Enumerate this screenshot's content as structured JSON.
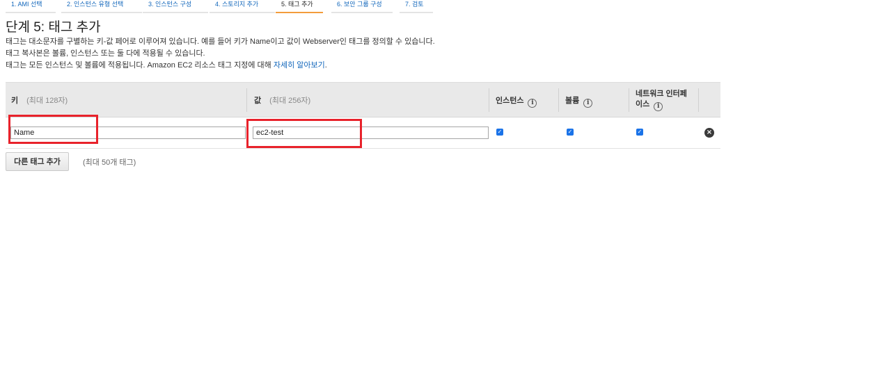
{
  "wizard": {
    "steps": [
      {
        "label": "1. AMI 선택"
      },
      {
        "label": "2. 인스턴스 유형 선택"
      },
      {
        "label": "3. 인스턴스 구성"
      },
      {
        "label": "4. 스토리지 추가"
      },
      {
        "label": "5. 태그 추가",
        "active": true
      },
      {
        "label": "6. 보안 그룹 구성"
      },
      {
        "label": "7. 검토"
      }
    ]
  },
  "page": {
    "title": "단계 5: 태그 추가",
    "desc_line1": "태그는 대소문자를 구별하는 키-값 페어로 이루어져 있습니다. 예를 들어 키가 Name이고 값이 Webserver인 태그를 정의할 수 있습니다.",
    "desc_line2": "태그 복사본은 볼륨, 인스턴스 또는 둘 다에 적용될 수 있습니다.",
    "desc_line3": "태그는 모든 인스턴스 및 볼륨에 적용됩니다. Amazon EC2 리소스 태그 지정에 대해 ",
    "learn_more_link": "자세히 알아보기",
    "desc_line3_end": "."
  },
  "table": {
    "headers": {
      "key": "키",
      "key_hint": "(최대 128자)",
      "value": "값",
      "value_hint": "(최대 256자)",
      "instances": "인스턴스",
      "volumes": "볼륨",
      "network_interfaces_line1": "네트워크 인터페",
      "network_interfaces_line2": "이스"
    },
    "info_icon": "info-icon",
    "rows": [
      {
        "key": "Name",
        "value": "ec2-test",
        "instances_checked": true,
        "volumes_checked": true,
        "network_interfaces_checked": true
      }
    ]
  },
  "actions": {
    "add_tag_label": "다른 태그 추가",
    "max_note": "(최대 50개 태그)"
  },
  "colors": {
    "highlight": "#e8222b",
    "link": "#1166bb",
    "active_step": "#f39c3b",
    "checkbox": "#1a73e8"
  }
}
